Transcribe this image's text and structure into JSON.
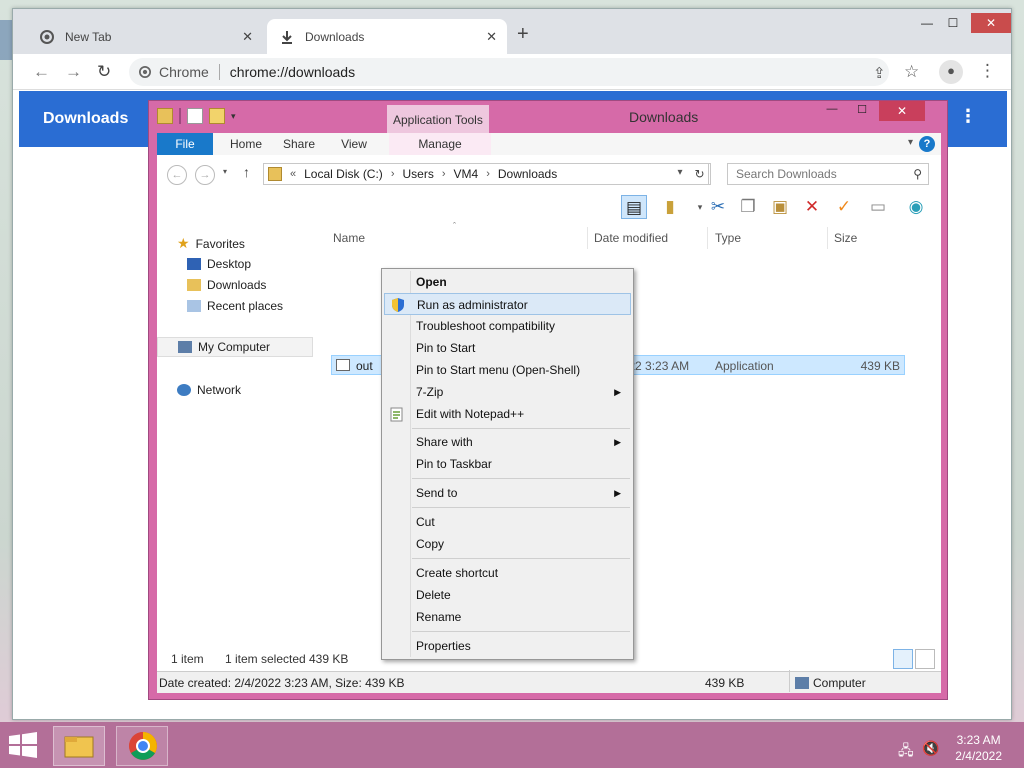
{
  "chrome": {
    "tabs": [
      {
        "label": "New Tab",
        "close": "✕"
      },
      {
        "label": "Downloads",
        "close": "✕"
      }
    ],
    "new_tab": "+",
    "window_controls": {
      "minimize": "—",
      "maximize": "☐",
      "close": "✕"
    },
    "nav": {
      "back": "←",
      "forward": "→",
      "reload": "↻"
    },
    "omnibox": {
      "site": "Chrome",
      "url": "chrome://downloads"
    },
    "actions": {
      "share": "⇪",
      "bookmark": "☆",
      "profile": "●",
      "menu": "⋮"
    }
  },
  "downloads_page": {
    "title": "Downloads",
    "more": "⋮"
  },
  "explorer": {
    "title": "Downloads",
    "contextual_tab_group": "Application Tools",
    "ribbon_tabs": [
      "File",
      "Home",
      "Share",
      "View",
      "Manage"
    ],
    "help": "?",
    "breadcrumb": {
      "prefix": "«",
      "parts": [
        "Local Disk (C:)",
        "Users",
        "VM4",
        "Downloads"
      ]
    },
    "search_placeholder": "Search Downloads",
    "nav_pane": {
      "favorites": "Favorites",
      "items": [
        "Desktop",
        "Downloads",
        "Recent places"
      ],
      "my_computer": "My Computer",
      "network": "Network"
    },
    "columns": [
      "Name",
      "Date modified",
      "Type",
      "Size"
    ],
    "files": [
      {
        "name": "out",
        "date": "2/4/2022 3:23 AM",
        "type": "Application",
        "size": "439 KB"
      }
    ],
    "status": {
      "count": "1 item",
      "selected": "1 item selected",
      "size": "439 KB"
    },
    "details_bar": {
      "info": "Date created: 2/4/2022 3:23 AM, Size: 439 KB",
      "size": "439 KB",
      "location": "Computer"
    }
  },
  "context_menu": {
    "items": [
      {
        "label": "Open"
      },
      {
        "label": "Run as administrator"
      },
      {
        "label": "Troubleshoot compatibility"
      },
      {
        "label": "Pin to Start"
      },
      {
        "label": "Pin to Start menu (Open-Shell)"
      },
      {
        "label": "7-Zip"
      },
      {
        "label": "Edit with Notepad++"
      },
      {
        "label": "Share with"
      },
      {
        "label": "Pin to Taskbar"
      },
      {
        "label": "Send to"
      },
      {
        "label": "Cut"
      },
      {
        "label": "Copy"
      },
      {
        "label": "Create shortcut"
      },
      {
        "label": "Delete"
      },
      {
        "label": "Rename"
      },
      {
        "label": "Properties"
      }
    ],
    "submenu_arrow": "▶"
  },
  "taskbar": {
    "time": "3:23 AM",
    "date": "2/4/2022"
  },
  "colors": {
    "accent": "#2a6dd3",
    "explorer_frame": "#d66aa8",
    "taskbar": "#b36f98",
    "selection": "#cde8ff"
  }
}
